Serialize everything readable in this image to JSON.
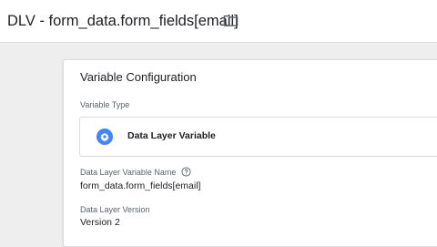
{
  "header": {
    "title": "DLV - form_data.form_fields[email]",
    "folder_icon": "folder-icon"
  },
  "card": {
    "title": "Variable Configuration",
    "variable_type_label": "Variable Type",
    "variable_type": {
      "name": "Data Layer Variable",
      "icon": "gear-icon",
      "icon_color": "#4285f4"
    },
    "dlv_name_label": "Data Layer Variable Name",
    "dlv_name_value": "form_data.form_fields[email]",
    "dlv_version_label": "Data Layer Version",
    "dlv_version_value": "Version 2"
  },
  "colors": {
    "background": "#eeeeee",
    "accent": "#4285f4"
  }
}
